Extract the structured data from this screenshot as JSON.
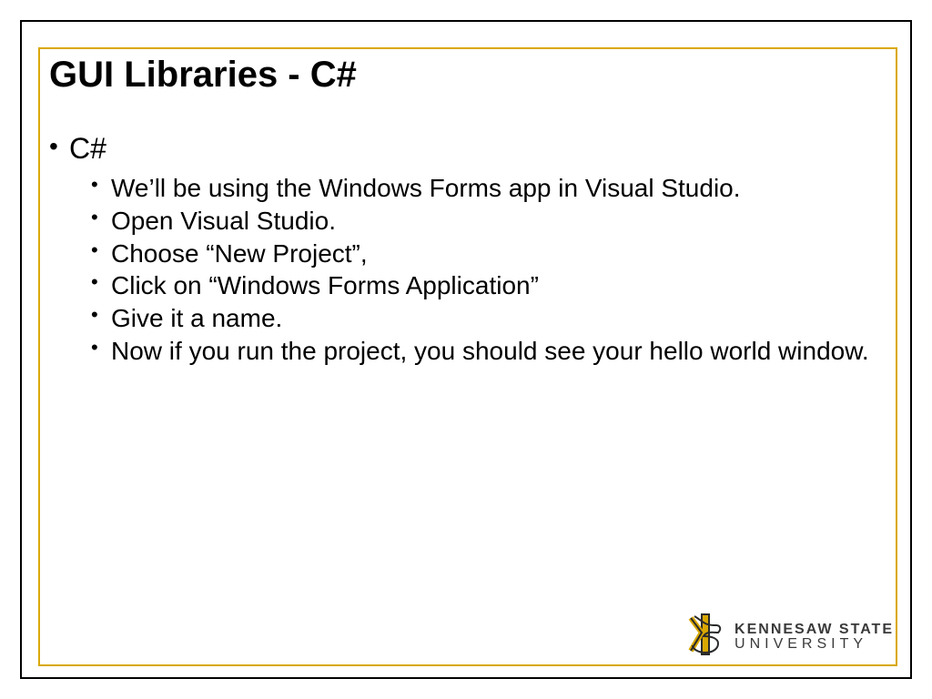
{
  "slide": {
    "title": "GUI Libraries - C#",
    "level1": {
      "heading": "C#",
      "items": [
        "We’ll be using the Windows Forms app in Visual Studio.",
        "Open Visual Studio.",
        "Choose “New Project”,",
        "Click on “Windows Forms Application”",
        "Give it a name.",
        "Now if you run the project, you should see your hello world window."
      ]
    }
  },
  "logo": {
    "line1": "KENNESAW STATE",
    "line2": "UNIVERSITY"
  },
  "colors": {
    "gold": "#d9a800",
    "black": "#000000"
  }
}
